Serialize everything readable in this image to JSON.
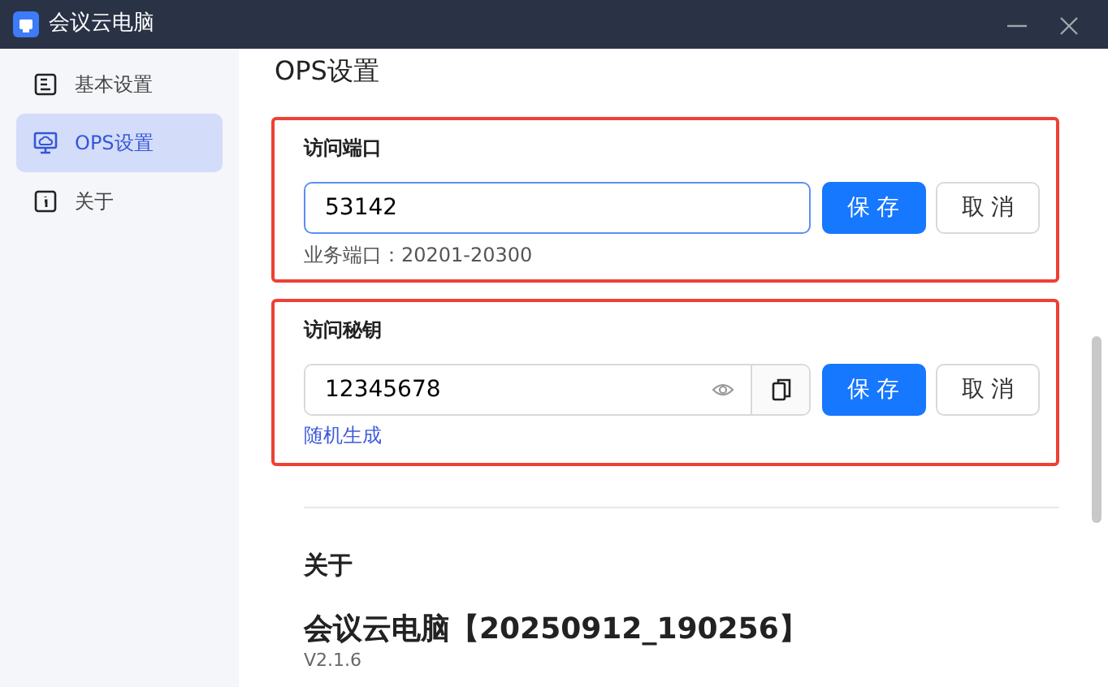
{
  "window": {
    "title": "会议云电脑"
  },
  "sidebar": {
    "items": [
      {
        "label": "基本设置",
        "selected": false,
        "kind": "doc"
      },
      {
        "label": "OPS设置",
        "selected": true,
        "kind": "screen"
      },
      {
        "label": "关于",
        "selected": false,
        "kind": "info"
      }
    ]
  },
  "ops_settings": {
    "heading": "OPS设置",
    "port": {
      "label": "访问端口",
      "value": "53142",
      "focused": true,
      "save": "保 存",
      "cancel": "取 消",
      "hint": "业务端口：20201-20300"
    },
    "secret": {
      "label": "访问秘钥",
      "value": "12345678",
      "save": "保 存",
      "cancel": "取 消",
      "link": "随机生成"
    }
  },
  "about": {
    "heading": "关于",
    "app_name": "会议云电脑【20250912_190256】",
    "version": "V2.1.6"
  }
}
